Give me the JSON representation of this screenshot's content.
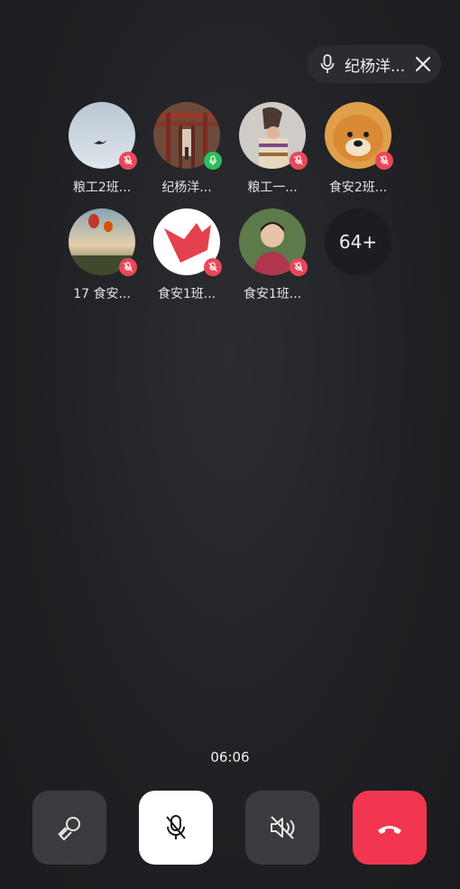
{
  "speaker": {
    "name": "纪杨洋..."
  },
  "members": [
    {
      "name": "粮工2班...",
      "status": "muted",
      "avatar": "bird-in-sky"
    },
    {
      "name": "纪杨洋...",
      "status": "active",
      "avatar": "torii-gate"
    },
    {
      "name": "粮工一...",
      "status": "muted",
      "avatar": "person-in-hat"
    },
    {
      "name": "食安2班...",
      "status": "muted",
      "avatar": "shiba-dog"
    },
    {
      "name": "17 食安...",
      "status": "muted",
      "avatar": "hot-air-balloons"
    },
    {
      "name": "食安1班...",
      "status": "muted",
      "avatar": "red-origami"
    },
    {
      "name": "食安1班...",
      "status": "muted",
      "avatar": "girl-portrait"
    }
  ],
  "more_count": "64+",
  "timer": "06:06",
  "controls": [
    {
      "name": "speaker-toggle",
      "icon": "speaker-off-icon"
    },
    {
      "name": "mute-toggle",
      "icon": "mic-off-icon"
    },
    {
      "name": "volume-toggle",
      "icon": "volume-off-icon"
    },
    {
      "name": "hangup",
      "icon": "hangup-icon"
    }
  ],
  "colors": {
    "muted": "#e9475a",
    "active": "#2dbd5a",
    "hangup": "#f2364f"
  }
}
